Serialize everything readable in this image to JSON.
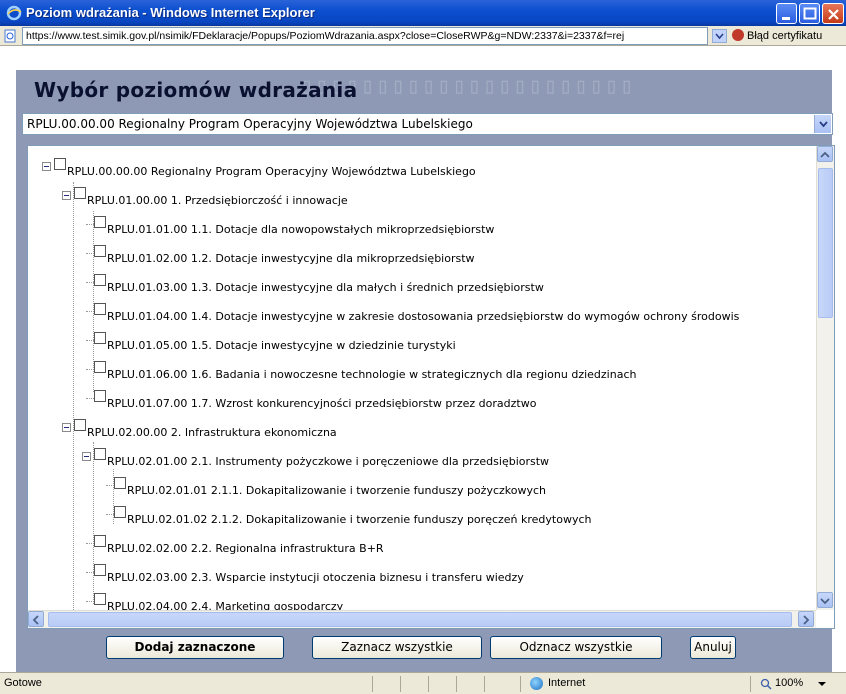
{
  "window": {
    "title": "Poziom wdrażania - Windows Internet Explorer",
    "url": "https://www.test.simik.gov.pl/nsimik/FDeklaracje/Popups/PoziomWdrazania.aspx?close=CloseRWP&g=NDW:2337&i=2337&f=rej",
    "cert_error": "Błąd certyfikatu"
  },
  "dialog": {
    "title": "Wybór poziomów wdrażania",
    "select_value": "RPLU.00.00.00 Regionalny Program Operacyjny Województwa Lubelskiego"
  },
  "tree": [
    {
      "level": 0,
      "expander": true,
      "label": "RPLU.00.00.00 Regionalny Program Operacyjny Województwa Lubelskiego"
    },
    {
      "level": 1,
      "expander": true,
      "label": "RPLU.01.00.00 1. Przedsiębiorczość i innowacje"
    },
    {
      "level": 2,
      "expander": false,
      "label": "RPLU.01.01.00 1.1. Dotacje dla nowopowstałych mikroprzedsiębiorstw"
    },
    {
      "level": 2,
      "expander": false,
      "label": "RPLU.01.02.00 1.2. Dotacje inwestycyjne dla mikroprzedsiębiorstw"
    },
    {
      "level": 2,
      "expander": false,
      "label": "RPLU.01.03.00 1.3. Dotacje inwestycyjne dla małych i średnich przedsiębiorstw"
    },
    {
      "level": 2,
      "expander": false,
      "label": "RPLU.01.04.00 1.4. Dotacje inwestycyjne w zakresie dostosowania przedsiębiorstw do wymogów ochrony środowis"
    },
    {
      "level": 2,
      "expander": false,
      "label": "RPLU.01.05.00 1.5. Dotacje inwestycyjne w dziedzinie turystyki"
    },
    {
      "level": 2,
      "expander": false,
      "label": "RPLU.01.06.00 1.6. Badania i nowoczesne technologie w strategicznych dla regionu dziedzinach"
    },
    {
      "level": 2,
      "expander": false,
      "label": "RPLU.01.07.00 1.7. Wzrost konkurencyjności przedsiębiorstw przez doradztwo"
    },
    {
      "level": 1,
      "expander": true,
      "label": "RPLU.02.00.00 2. Infrastruktura ekonomiczna"
    },
    {
      "level": 2,
      "expander": true,
      "label": "RPLU.02.01.00 2.1. Instrumenty pożyczkowe i poręczeniowe dla przedsiębiorstw"
    },
    {
      "level": 3,
      "expander": false,
      "label": "RPLU.02.01.01 2.1.1. Dokapitalizowanie i tworzenie funduszy pożyczkowych"
    },
    {
      "level": 3,
      "expander": false,
      "label": "RPLU.02.01.02 2.1.2. Dokapitalizowanie i tworzenie funduszy poręczeń kredytowych"
    },
    {
      "level": 2,
      "expander": false,
      "label": "RPLU.02.02.00 2.2. Regionalna infrastruktura B+R"
    },
    {
      "level": 2,
      "expander": false,
      "label": "RPLU.02.03.00 2.3. Wsparcie instytucji otoczenia biznesu i transferu wiedzy"
    },
    {
      "level": 2,
      "expander": false,
      "label": "RPLU.02.04.00 2.4. Marketing gospodarczy"
    }
  ],
  "buttons": {
    "add": "Dodaj zaznaczone",
    "select_all": "Zaznacz wszystkie",
    "deselect_all": "Odznacz wszystkie",
    "cancel": "Anuluj"
  },
  "status": {
    "left": "Gotowe",
    "zone": "Internet",
    "zoom": "100%"
  }
}
